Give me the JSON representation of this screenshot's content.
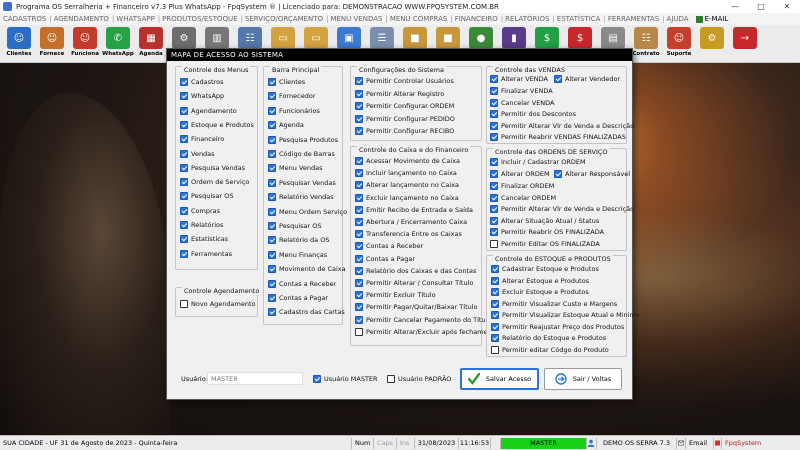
{
  "window": {
    "title": "Programa OS Serralheria + Financeiro v7.3 Plus WhatsApp - FpqSystem ® | Licenciado para: DEMONSTRACAO WWW.FPQSYSTEM.COM.BR",
    "minimize": "—",
    "maximize": "□",
    "close": "✕"
  },
  "menu": {
    "items": [
      "CADASTROS",
      "AGENDAMENTO",
      "WHATSAPP",
      "PRODUTOS/ESTOQUE",
      "SERVIÇO/ORÇAMENTO",
      "MENU VENDAS",
      "MENU COMPRAS",
      "FINANCEIRO",
      "RELATÓRIOS",
      "ESTATÍSTICA",
      "FERRAMENTAS",
      "AJUDA"
    ],
    "email": "E-MAIL"
  },
  "toolbar": {
    "buttons": [
      {
        "label": "Clientes",
        "icon": "clients-icon",
        "color": "#2b6cc4"
      },
      {
        "label": "Fornece",
        "icon": "suppliers-icon",
        "color": "#c4702b"
      },
      {
        "label": "Funciona",
        "icon": "employees-icon",
        "color": "#c43b2b"
      },
      {
        "label": "WhatsApp",
        "icon": "whatsapp-icon",
        "color": "#25a244"
      },
      {
        "label": "Agenda",
        "icon": "calendar-icon",
        "color": "#b9312c"
      },
      {
        "label": "",
        "icon": "settings-icon",
        "color": "#6d6d6d"
      },
      {
        "label": "",
        "icon": "building-icon",
        "color": "#777777"
      },
      {
        "label": "",
        "icon": "document-icon",
        "color": "#5577a9"
      },
      {
        "label": "",
        "icon": "folder-icon",
        "color": "#d5a240"
      },
      {
        "label": "",
        "icon": "folder-icon",
        "color": "#d5a240"
      },
      {
        "label": "",
        "icon": "monitor-icon",
        "color": "#3b7ad0"
      },
      {
        "label": "",
        "icon": "report-icon",
        "color": "#7a8fb0"
      },
      {
        "label": "",
        "icon": "box-icon",
        "color": "#c8973a"
      },
      {
        "label": "",
        "icon": "box-icon",
        "color": "#c8973a"
      },
      {
        "label": "",
        "icon": "globe-icon",
        "color": "#3a8a3a"
      },
      {
        "label": "",
        "icon": "book-icon",
        "color": "#5a3a8a"
      },
      {
        "label": "",
        "icon": "money-icon",
        "color": "#23a046"
      },
      {
        "label": "",
        "icon": "money-icon",
        "color": "#c8272b"
      },
      {
        "label": "",
        "icon": "cash-icon",
        "color": "#8a8a8a"
      },
      {
        "label": "Contrato",
        "icon": "contract-icon",
        "color": "#b8874a"
      },
      {
        "label": "Suporte",
        "icon": "support-icon",
        "color": "#c4402b"
      },
      {
        "label": "",
        "icon": "gear-gold-icon",
        "color": "#c59b22"
      },
      {
        "label": "",
        "icon": "exit-icon",
        "color": "#c8272b"
      }
    ]
  },
  "modal": {
    "title": "MAPA DE ACESSO AO SISTEMA",
    "groups": {
      "menus": {
        "title": "Controle dos Menus",
        "items": [
          {
            "label": "Cadastros",
            "checked": true
          },
          {
            "label": "WhatsApp",
            "checked": true
          },
          {
            "label": "Agendamento",
            "checked": true
          },
          {
            "label": "Estoque e Produtos",
            "checked": true
          },
          {
            "label": "Financeiro",
            "checked": true
          },
          {
            "label": "Vendas",
            "checked": true
          },
          {
            "label": "Pesquisa Vendas",
            "checked": true
          },
          {
            "label": "Ordem de Serviço",
            "checked": true
          },
          {
            "label": "Pesquisar OS",
            "checked": true
          },
          {
            "label": "Compras",
            "checked": true
          },
          {
            "label": "Relatórios",
            "checked": true
          },
          {
            "label": "Estatísticas",
            "checked": true
          },
          {
            "label": "Ferramentas",
            "checked": true
          }
        ]
      },
      "agendamento": {
        "title": "Controle Agendamento",
        "items": [
          {
            "label": "Novo Agendamento",
            "checked": false
          }
        ]
      },
      "barra": {
        "title": "Barra Principal",
        "items": [
          {
            "label": "Clientes",
            "checked": true
          },
          {
            "label": "Fornecedor",
            "checked": true
          },
          {
            "label": "Funcionários",
            "checked": true
          },
          {
            "label": "Agenda",
            "checked": true
          },
          {
            "label": "Pesquisa Produtos",
            "checked": true
          },
          {
            "label": "Código de Barras",
            "checked": true
          },
          {
            "label": "Menu Vendas",
            "checked": true
          },
          {
            "label": "Pesquisar Vendas",
            "checked": true
          },
          {
            "label": "Relatório Vendas",
            "checked": true
          },
          {
            "label": "Menu Ordem Serviço",
            "checked": true
          },
          {
            "label": "Pesquisar OS",
            "checked": true
          },
          {
            "label": "Relatório da OS",
            "checked": true
          },
          {
            "label": "Menu Finanças",
            "checked": true
          },
          {
            "label": "Movimento de Caixa",
            "checked": true
          },
          {
            "label": "Contas a Receber",
            "checked": true
          },
          {
            "label": "Contas a Pagar",
            "checked": true
          },
          {
            "label": "Cadastro das Cartas",
            "checked": true
          }
        ]
      },
      "config": {
        "title": "Configurações do Sistema",
        "items": [
          {
            "label": "Permitir Controlar Usuários",
            "checked": true
          },
          {
            "label": "Permitir Alterar Registro",
            "checked": true
          },
          {
            "label": "Permitir Configurar ORDEM",
            "checked": true
          },
          {
            "label": "Permitir Configurar PEDIDO",
            "checked": true
          },
          {
            "label": "Permitir Configurar RECIBO",
            "checked": true
          }
        ]
      },
      "caixa": {
        "title": "Controle do Caixa e do Financeiro",
        "items": [
          {
            "label": "Acessar Movimento de Caixa",
            "checked": true
          },
          {
            "label": "Incluir lançamento no Caixa",
            "checked": true
          },
          {
            "label": "Alterar lançamento no Caixa",
            "checked": true
          },
          {
            "label": "Excluir lançamento no Caixa",
            "checked": true
          },
          {
            "label": "Emitir Recibo de Entrada e Saída",
            "checked": true
          },
          {
            "label": "Abertura / Encerramento Caixa",
            "checked": true
          },
          {
            "label": "Transferencia Entre os Caixas",
            "checked": true
          },
          {
            "label": "Contas a Receber",
            "checked": true
          },
          {
            "label": "Contas a Pagar",
            "checked": true
          },
          {
            "label": "Relatório dos Caixas e das Contas",
            "checked": true
          },
          {
            "label": "Permitir Alterar / Consultar Título",
            "checked": true
          },
          {
            "label": "Permitir Excluir Título",
            "checked": true
          },
          {
            "label": "Permitir Pagar/Quitar/Baixar Título",
            "checked": true
          },
          {
            "label": "Permitir Cancelar Pagamento do Título",
            "checked": true
          },
          {
            "label": "Permitir Alterar/Excluir após fechamento",
            "checked": false
          }
        ]
      },
      "vendas": {
        "title": "Controle das VENDAS",
        "alterar_venda": {
          "label": "Alterar VENDA",
          "checked": true
        },
        "alterar_vendedor": {
          "label": "Alterar Vendedor",
          "checked": true
        },
        "items": [
          {
            "label": "Finalizar VENDA",
            "checked": true
          },
          {
            "label": "Cancelar VENDA",
            "checked": true
          },
          {
            "label": "Permitir dos Descontos",
            "checked": true
          },
          {
            "label": "Permitir Alterar Vlr de Venda e Descrição",
            "checked": true
          },
          {
            "label": "Permitir Reabrir VENDAS FINALIZADAS",
            "checked": true
          }
        ]
      },
      "ordens": {
        "title": "Controle das ORDENS DE SERVIÇO",
        "incluir": {
          "label": "Incluir / Cadastrar ORDEM",
          "checked": true
        },
        "alterar_ordem": {
          "label": "Alterar ORDEM",
          "checked": true
        },
        "alterar_responsavel": {
          "label": "Alterar Responsável",
          "checked": true
        },
        "items": [
          {
            "label": "Finalizar ORDEM",
            "checked": true
          },
          {
            "label": "Cancelar ORDEM",
            "checked": true
          },
          {
            "label": "Permitir Alterar Vlr de Venda e Descrição",
            "checked": true
          },
          {
            "label": "Alterar Situação Atual / Status",
            "checked": true
          },
          {
            "label": "Permitir Reabrir OS FINALIZADA",
            "checked": true
          },
          {
            "label": "Permitir Editar OS FINALIZADA",
            "checked": false
          }
        ]
      },
      "estoque": {
        "title": "Controle do ESTOQUE e PRODUTOS",
        "items": [
          {
            "label": "Cadastrar Estoque e Produtos",
            "checked": true
          },
          {
            "label": "Alterar Estoque e Produtos",
            "checked": true
          },
          {
            "label": "Excluir Estoque e Produtos",
            "checked": true
          },
          {
            "label": "Permitir Visualizar Custo e Margens",
            "checked": true
          },
          {
            "label": "Permitir Visualizar Estoque Atual e Minimo",
            "checked": true
          },
          {
            "label": "Permitir Reajustar Preço dos Produtos",
            "checked": true
          },
          {
            "label": "Relatório do Estoque e Produtos",
            "checked": true
          },
          {
            "label": "Permitir editar Códgo do Produto",
            "checked": false
          }
        ]
      }
    },
    "footer": {
      "user_label": "Usuário:",
      "user_value": "MASTER",
      "usuario_master": {
        "label": "Usuário MASTER",
        "checked": true
      },
      "usuario_padrao": {
        "label": "Usuário PADRÃO",
        "checked": false
      },
      "save_label": "Salvar Acesso",
      "exit_label": "Sair / Voltas"
    }
  },
  "status": {
    "city": "SUA CIDADE - UF 31 de Agosto de 2023 - Quinta-feira",
    "num": "Num",
    "caps": "Caps",
    "ins": "Ins",
    "date": "31/08/2023",
    "time": "11:16:53",
    "user": "MASTER",
    "demo": "DEMO OS SERRA 7.3",
    "email": "Email",
    "brand": "FpqSystem"
  },
  "colors": {
    "accent": "#2a73d9",
    "status_green": "#18d016",
    "modal_title_bg": "#000000"
  }
}
